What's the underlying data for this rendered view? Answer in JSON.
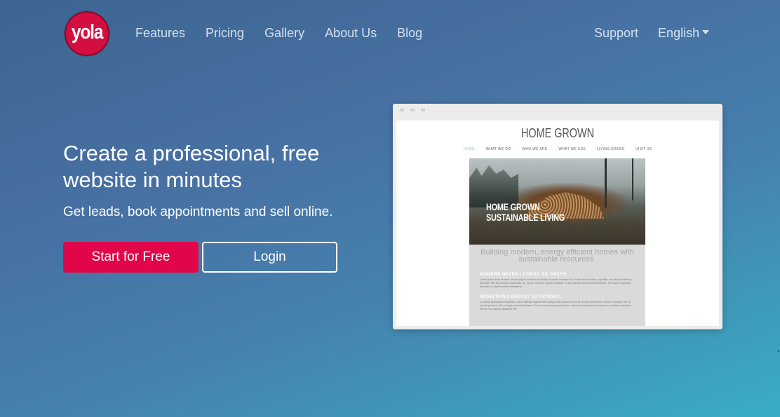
{
  "header": {
    "logo_text": "yola",
    "nav": [
      "Features",
      "Pricing",
      "Gallery",
      "About Us",
      "Blog"
    ],
    "support_label": "Support",
    "language_label": "English"
  },
  "hero": {
    "title": "Create a professional, free website in minutes",
    "subtitle": "Get leads, book appointments and sell online.",
    "primary_button": "Start for Free",
    "secondary_button": "Login"
  },
  "preview": {
    "site_title": "HOME GROWN",
    "site_nav": [
      "HOME",
      "WHAT WE DO",
      "WHO WE ARE",
      "WHAT WE USE",
      "LIVING GREEN",
      "VISIT US"
    ],
    "image_caption_line1": "HOME GROWN",
    "image_caption_line2": "SUSTAINABLE LIVING",
    "lead": "Building modern, energy efficient homes with sustainable resources.",
    "section1_heading": "MODERN NEVER LOOKED SO GREEN.",
    "section1_text": "Lorem ipsum dolor sit amet, mea ei populo nostrum consulatu, eu nonne recteque ius. Et mei alia iracundia, vulputate, duis id illud habemus percipitur. Mei id nominati complectitur ius, ius an commune epicuri molestiae. In sale fabulas assueverit definitionem. Per laoreet appareat periculis eu, at philosophia intellegebat.",
    "section2_heading": "REDEFINING ENERGY EFFICIENCY.",
    "section2_text": "Cu aperiri pertinacia complectitur, vis an fabellas argumentum, saepe probo graeci cu est. Ei omnium deleniti vel, munere repudiare mel no, an inis ipsum pro. Ex vel legere eirmod salutatus. Eu eos modo quaeque patrioque, vel purus reprimique incorrupte no, an fuisset repudiare mel ad, ius volumus appareat mei."
  },
  "colors": {
    "brand_red": "#d40e3f",
    "primary_button": "#e1064a",
    "nav_text": "#d2e0f1"
  }
}
